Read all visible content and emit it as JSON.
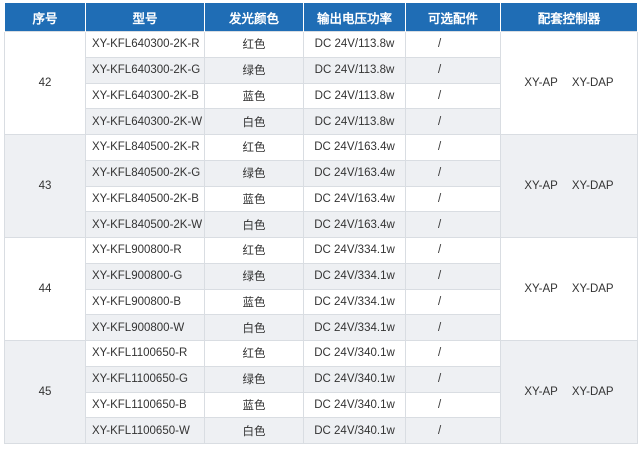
{
  "table": {
    "headers": {
      "no": "序号",
      "model": "型号",
      "color": "发光颜色",
      "power": "输出电压功率",
      "accessory": "可选配件",
      "controller": "配套控制器"
    },
    "groups": [
      {
        "no": "42",
        "controllers": [
          "XY-AP",
          "XY-DAP"
        ],
        "rows": [
          {
            "model": "XY-KFL640300-2K-R",
            "color": "红色",
            "power": "DC 24V/113.8w",
            "accessory": "/"
          },
          {
            "model": "XY-KFL640300-2K-G",
            "color": "绿色",
            "power": "DC 24V/113.8w",
            "accessory": "/"
          },
          {
            "model": "XY-KFL640300-2K-B",
            "color": "蓝色",
            "power": "DC 24V/113.8w",
            "accessory": "/"
          },
          {
            "model": "XY-KFL640300-2K-W",
            "color": "白色",
            "power": "DC 24V/113.8w",
            "accessory": "/"
          }
        ]
      },
      {
        "no": "43",
        "controllers": [
          "XY-AP",
          "XY-DAP"
        ],
        "rows": [
          {
            "model": "XY-KFL840500-2K-R",
            "color": "红色",
            "power": "DC 24V/163.4w",
            "accessory": "/"
          },
          {
            "model": "XY-KFL840500-2K-G",
            "color": "绿色",
            "power": "DC 24V/163.4w",
            "accessory": "/"
          },
          {
            "model": "XY-KFL840500-2K-B",
            "color": "蓝色",
            "power": "DC 24V/163.4w",
            "accessory": "/"
          },
          {
            "model": "XY-KFL840500-2K-W",
            "color": "白色",
            "power": "DC 24V/163.4w",
            "accessory": "/"
          }
        ]
      },
      {
        "no": "44",
        "controllers": [
          "XY-AP",
          "XY-DAP"
        ],
        "rows": [
          {
            "model": "XY-KFL900800-R",
            "color": "红色",
            "power": "DC 24V/334.1w",
            "accessory": "/"
          },
          {
            "model": "XY-KFL900800-G",
            "color": "绿色",
            "power": "DC 24V/334.1w",
            "accessory": "/"
          },
          {
            "model": "XY-KFL900800-B",
            "color": "蓝色",
            "power": "DC 24V/334.1w",
            "accessory": "/"
          },
          {
            "model": "XY-KFL900800-W",
            "color": "白色",
            "power": "DC 24V/334.1w",
            "accessory": "/"
          }
        ]
      },
      {
        "no": "45",
        "controllers": [
          "XY-AP",
          "XY-DAP"
        ],
        "rows": [
          {
            "model": "XY-KFL1100650-R",
            "color": "红色",
            "power": "DC 24V/340.1w",
            "accessory": "/"
          },
          {
            "model": "XY-KFL1100650-G",
            "color": "绿色",
            "power": "DC 24V/340.1w",
            "accessory": "/"
          },
          {
            "model": "XY-KFL1100650-B",
            "color": "蓝色",
            "power": "DC 24V/340.1w",
            "accessory": "/"
          },
          {
            "model": "XY-KFL1100650-W",
            "color": "白色",
            "power": "DC 24V/340.1w",
            "accessory": "/"
          }
        ]
      }
    ]
  },
  "colors": {
    "header_bg": "#1f6db5",
    "header_text": "#ffffff",
    "stripe": "#eef0f3",
    "border": "#d9dde2",
    "text": "#333333"
  }
}
